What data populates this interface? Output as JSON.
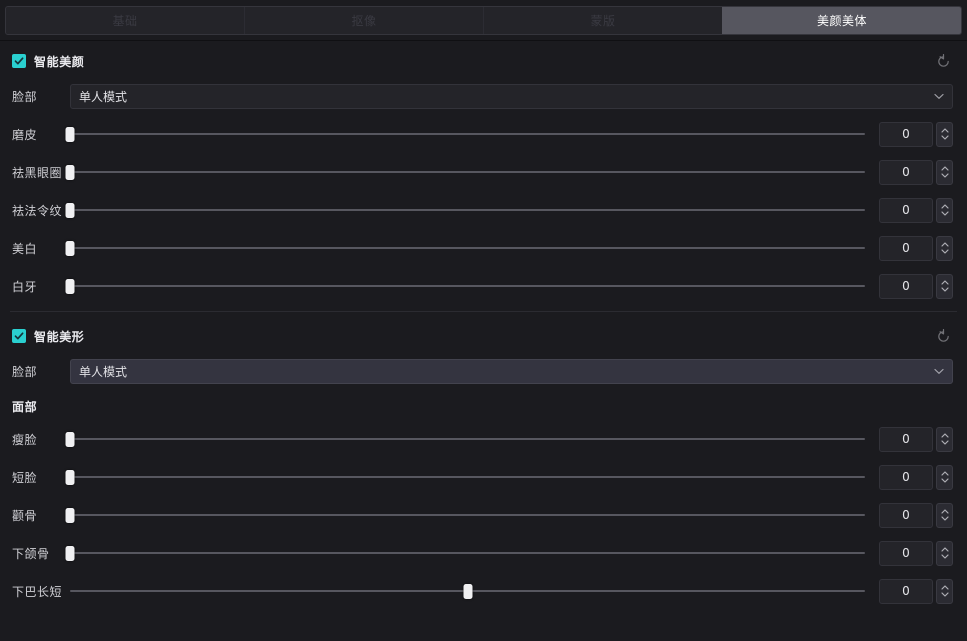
{
  "tabs": [
    {
      "label": "基础",
      "active": false
    },
    {
      "label": "抠像",
      "active": false
    },
    {
      "label": "蒙版",
      "active": false
    },
    {
      "label": "美颜美体",
      "active": true
    }
  ],
  "colors": {
    "accent": "#2ad0d0",
    "panel_bg": "#1b1b1f",
    "control_bg": "#242429",
    "active_tab_bg": "#56565f",
    "track": "#57575f",
    "knob": "#f0f0f2"
  },
  "sections": [
    {
      "title": "智能美颜",
      "checked": true,
      "reset_icon": "reset-circular-arrow-icon",
      "face_row": {
        "label": "脸部",
        "value": "单人模式",
        "chevron_icon": "chevron-down-icon",
        "hover": false
      },
      "sliders": [
        {
          "label": "磨皮",
          "value": "0",
          "min": 0,
          "max": 100,
          "percent": 0
        },
        {
          "label": "祛黑眼圈",
          "value": "0",
          "min": 0,
          "max": 100,
          "percent": 0
        },
        {
          "label": "祛法令纹",
          "value": "0",
          "min": 0,
          "max": 100,
          "percent": 0
        },
        {
          "label": "美白",
          "value": "0",
          "min": 0,
          "max": 100,
          "percent": 0
        },
        {
          "label": "白牙",
          "value": "0",
          "min": 0,
          "max": 100,
          "percent": 0
        }
      ]
    },
    {
      "title": "智能美形",
      "checked": true,
      "reset_icon": "reset-circular-arrow-icon",
      "face_row": {
        "label": "脸部",
        "value": "单人模式",
        "chevron_icon": "chevron-down-icon",
        "hover": true
      },
      "subheading": "面部",
      "sliders": [
        {
          "label": "瘦脸",
          "value": "0",
          "min": 0,
          "max": 100,
          "percent": 0
        },
        {
          "label": "短脸",
          "value": "0",
          "min": 0,
          "max": 100,
          "percent": 0
        },
        {
          "label": "颧骨",
          "value": "0",
          "min": 0,
          "max": 100,
          "percent": 0
        },
        {
          "label": "下颌骨",
          "value": "0",
          "min": 0,
          "max": 100,
          "percent": 0
        },
        {
          "label": "下巴长短",
          "value": "0",
          "min": -100,
          "max": 100,
          "percent": 50
        }
      ]
    }
  ]
}
